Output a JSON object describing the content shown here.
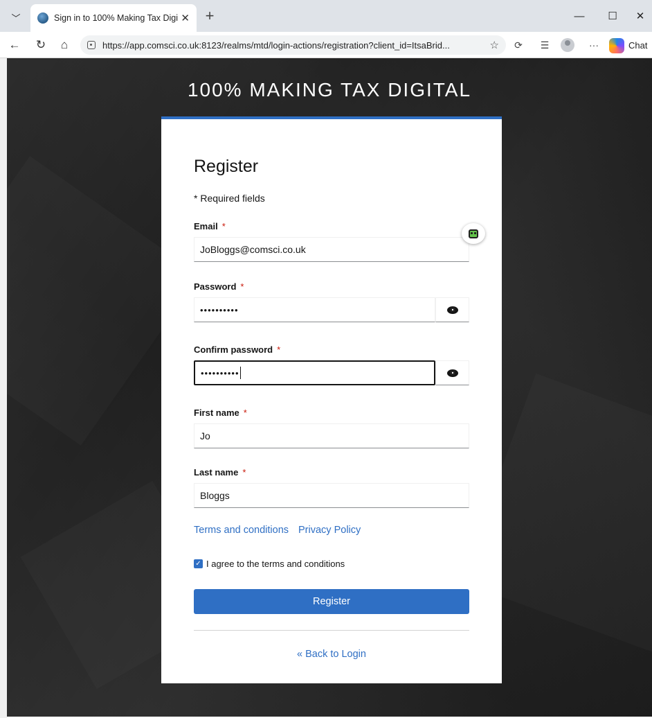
{
  "browser": {
    "tab_title": "Sign in to 100% Making Tax Digital",
    "tab_close": "✕",
    "new_tab": "+",
    "url": "https://app.comsci.co.uk:8123/realms/mtd/login-actions/registration?client_id=ItsaBrid...",
    "chat_label": "Chat",
    "icons": [
      "tab-list-icon",
      "back-arrow-icon",
      "refresh-icon",
      "home-icon",
      "lock-icon",
      "favorite-star-icon",
      "extensions-icon",
      "favorites-icon",
      "profile-icon",
      "more-icon",
      "copilot-icon",
      "minimize-icon",
      "maximize-icon",
      "close-window-icon"
    ]
  },
  "page": {
    "brand": "100% MAKING TAX DIGITAL",
    "heading": "Register",
    "required_note": "* Required fields",
    "fields": {
      "email": {
        "label": "Email",
        "required": "*",
        "value": "JoBloggs@comsci.co.uk"
      },
      "password": {
        "label": "Password",
        "required": "*",
        "value": "••••••••••"
      },
      "confirm_password": {
        "label": "Confirm password",
        "required": "*",
        "value": "••••••••••"
      },
      "first_name": {
        "label": "First name",
        "required": "*",
        "value": "Jo"
      },
      "last_name": {
        "label": "Last name",
        "required": "*",
        "value": "Bloggs"
      }
    },
    "terms_link": "Terms and conditions",
    "privacy_link": "Privacy Policy",
    "agree_label": "I agree to the terms and conditions",
    "agree_checked": true,
    "register_button": "Register",
    "back_link": "« Back to Login"
  },
  "colors": {
    "accent": "#2f6fc4",
    "required_star": "#c9190b",
    "background": "#222222"
  }
}
